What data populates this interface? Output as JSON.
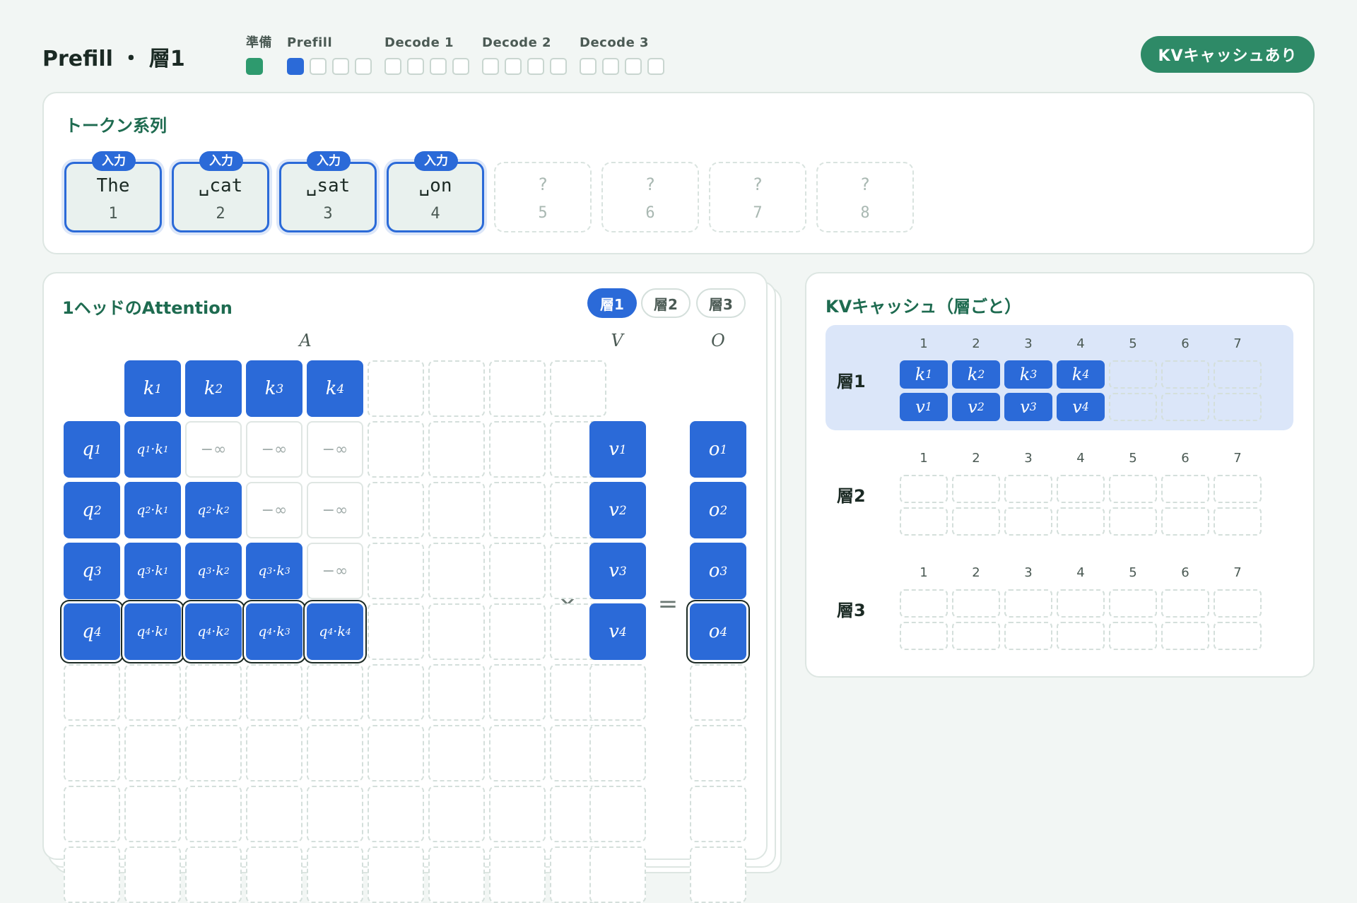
{
  "header": {
    "title": "Prefill ・ 層1",
    "phases": [
      {
        "label": "準備",
        "boxes": [
          "done"
        ]
      },
      {
        "label": "Prefill",
        "boxes": [
          "current",
          "pending",
          "pending",
          "pending"
        ]
      },
      {
        "label": "Decode 1",
        "boxes": [
          "pending",
          "pending",
          "pending",
          "pending"
        ]
      },
      {
        "label": "Decode 2",
        "boxes": [
          "pending",
          "pending",
          "pending",
          "pending"
        ]
      },
      {
        "label": "Decode 3",
        "boxes": [
          "pending",
          "pending",
          "pending",
          "pending"
        ]
      }
    ],
    "kv_toggle_label": "KVキャッシュあり"
  },
  "tokens": {
    "title": "トークン系列",
    "items": [
      {
        "text": "The",
        "index": "1",
        "badge": "入力"
      },
      {
        "text": "␣cat",
        "index": "2",
        "badge": "入力"
      },
      {
        "text": "␣sat",
        "index": "3",
        "badge": "入力"
      },
      {
        "text": "␣on",
        "index": "4",
        "badge": "入力"
      },
      {
        "text": "?",
        "index": "5"
      },
      {
        "text": "?",
        "index": "6"
      },
      {
        "text": "?",
        "index": "7"
      },
      {
        "text": "?",
        "index": "8"
      }
    ]
  },
  "attention": {
    "title": "1ヘッドのAttention",
    "layer_tabs": [
      "層1",
      "層2",
      "層3"
    ],
    "active_tab": 0,
    "label_A": "A",
    "label_V": "V",
    "label_O": "O",
    "times_symbol": "×",
    "equals_symbol": "=",
    "neg_inf": "−∞",
    "active_positions": 4,
    "total_positions": 8,
    "highlight_row": 4
  },
  "kv_cache": {
    "title": "KVキャッシュ（層ごと）",
    "slot_numbers": [
      "1",
      "2",
      "3",
      "4",
      "5",
      "6",
      "7"
    ],
    "layers": [
      {
        "name": "層1",
        "filled": 4,
        "active": true
      },
      {
        "name": "層2",
        "filled": 0,
        "active": false
      },
      {
        "name": "層3",
        "filled": 0,
        "active": false
      }
    ]
  },
  "colors": {
    "accent_blue": "#2b6ad8",
    "brand_green": "#2e8a67",
    "done_green": "#2e9a6e",
    "title_green": "#1e6b50"
  }
}
